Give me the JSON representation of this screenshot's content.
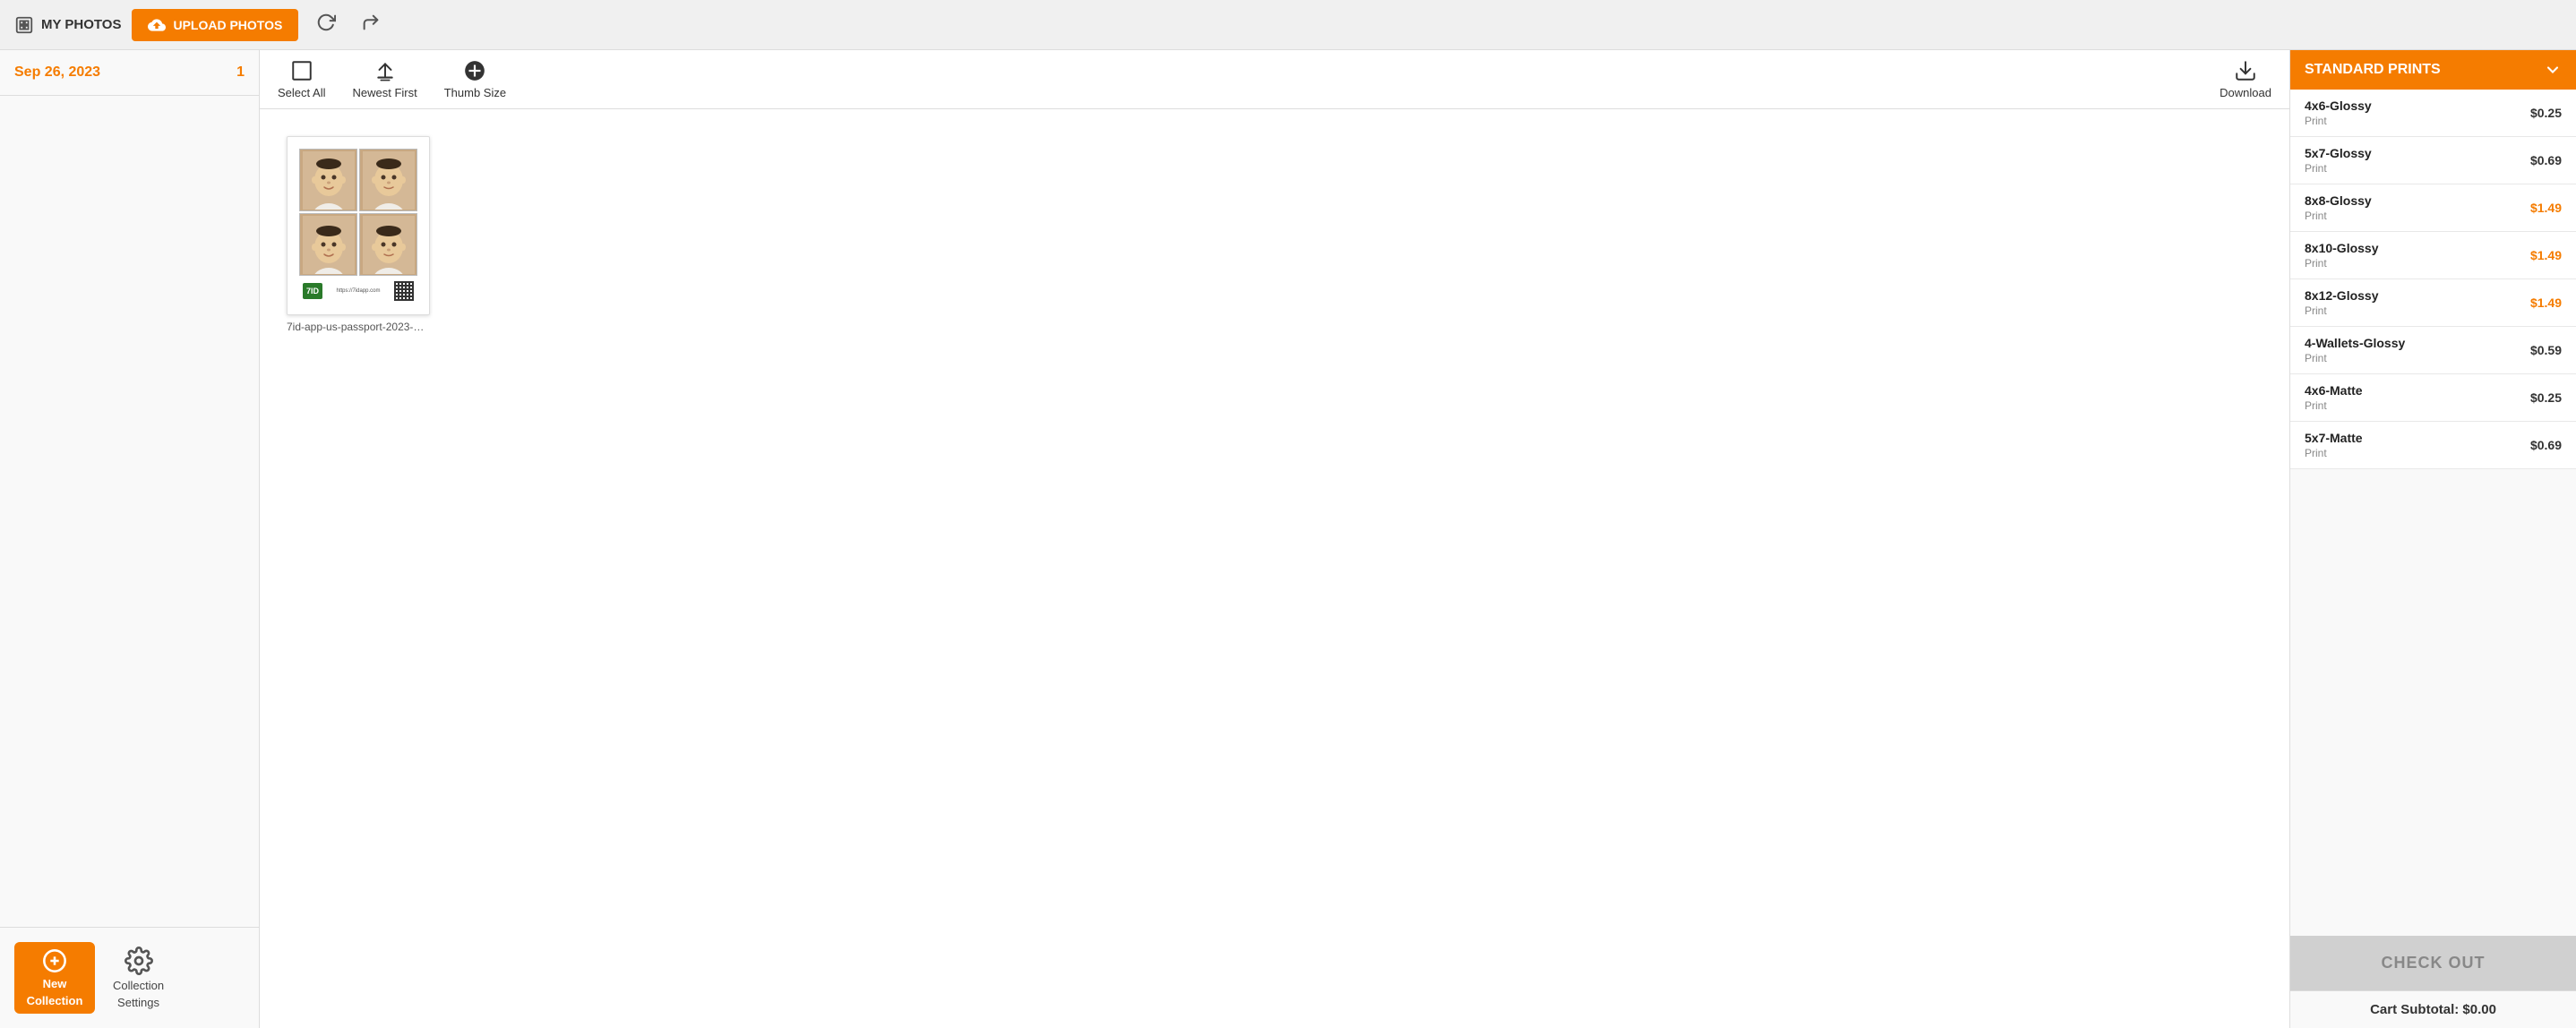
{
  "header": {
    "my_photos_label": "MY PHOTOS",
    "upload_photos_label": "UPLOAD PHOTOS"
  },
  "sidebar": {
    "date_label": "Sep 26, 2023",
    "date_count": "1",
    "new_collection_label": "New\nCollection",
    "new_collection_line1": "New",
    "new_collection_line2": "Collection",
    "collection_settings_label": "Collection\nSettings",
    "collection_settings_line1": "Collection",
    "collection_settings_line2": "Settings"
  },
  "toolbar": {
    "select_all_label": "Select All",
    "newest_first_label": "Newest First",
    "thumb_size_label": "Thumb Size",
    "download_label": "Download"
  },
  "photos": [
    {
      "id": "photo-1",
      "label": "7id-app-us-passport-2023-09..."
    }
  ],
  "right_panel": {
    "header_label": "STANDARD PRINTS",
    "prints": [
      {
        "name": "4x6-Glossy",
        "type": "Print",
        "price": "$0.25",
        "highlight": false
      },
      {
        "name": "5x7-Glossy",
        "type": "Print",
        "price": "$0.69",
        "highlight": false
      },
      {
        "name": "8x8-Glossy",
        "type": "Print",
        "price": "$1.49",
        "highlight": true
      },
      {
        "name": "8x10-Glossy",
        "type": "Print",
        "price": "$1.49",
        "highlight": true
      },
      {
        "name": "8x12-Glossy",
        "type": "Print",
        "price": "$1.49",
        "highlight": true
      },
      {
        "name": "4-Wallets-Glossy",
        "type": "Print",
        "price": "$0.59",
        "highlight": false
      },
      {
        "name": "4x6-Matte",
        "type": "Print",
        "price": "$0.25",
        "highlight": false
      },
      {
        "name": "5x7-Matte",
        "type": "Print",
        "price": "$0.69",
        "highlight": false
      }
    ],
    "checkout_label": "CHECK OUT",
    "cart_subtotal_label": "Cart Subtotal: $0.00"
  }
}
